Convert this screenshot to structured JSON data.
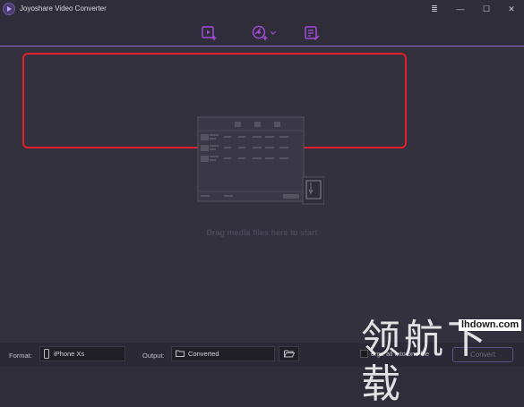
{
  "window": {
    "title": "Joyoshare Video Converter",
    "controls": [
      "≣",
      "—",
      "☐",
      "✕"
    ]
  },
  "toolbar": {
    "icons": [
      "add-video-icon",
      "add-dvd-icon",
      "task-list-icon"
    ],
    "accent": "#a24bd8"
  },
  "main": {
    "drop_text": "Drag media files here to start"
  },
  "footer": {
    "format_label": "Format:",
    "format_value": "iPhone Xs",
    "output_label": "Output:",
    "output_value": "Converted",
    "merge_label": "erge all into one file",
    "convert_label": "Convert"
  },
  "watermark": {
    "cn": "领航下载",
    "url": "lhdown.com"
  },
  "colors": {
    "highlight": "#e0202a",
    "divider": "#8a6bd4"
  }
}
